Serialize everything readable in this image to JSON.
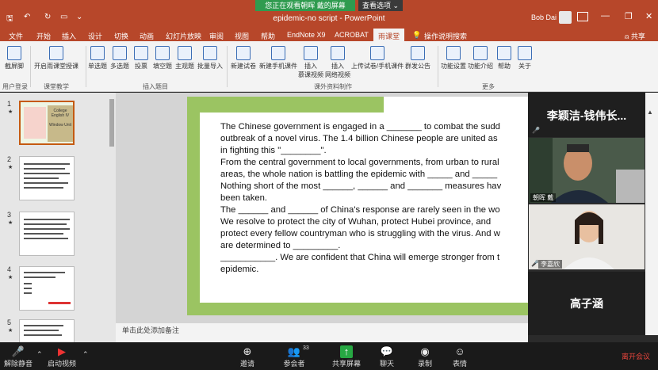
{
  "meeting": {
    "banner": "您正在观看朝晖 戴的屏幕",
    "view_options": "查看选项 ⌄"
  },
  "window": {
    "title": "epidemic-no script  -  PowerPoint",
    "user": "Bob Dai"
  },
  "tabs": [
    {
      "label": "文件"
    },
    {
      "label": "开始"
    },
    {
      "label": "插入"
    },
    {
      "label": "设计"
    },
    {
      "label": "切换"
    },
    {
      "label": "动画"
    },
    {
      "label": "幻灯片放映"
    },
    {
      "label": "审阅"
    },
    {
      "label": "视图"
    },
    {
      "label": "帮助"
    },
    {
      "label": "EndNote X9"
    },
    {
      "label": "ACROBAT"
    },
    {
      "label": "雨课堂"
    },
    {
      "label": "操作说明搜索"
    },
    {
      "label": "共享"
    }
  ],
  "ribbon": {
    "buttons": [
      {
        "label": "截屏脚"
      },
      {
        "label": "开启雨课堂授课"
      },
      {
        "label": "单选题"
      },
      {
        "label": "多选题"
      },
      {
        "label": "投票"
      },
      {
        "label": "填空题"
      },
      {
        "label": "主观题"
      },
      {
        "label": "批量导入"
      },
      {
        "label": "新建试卷"
      },
      {
        "label": "新建手机课件"
      },
      {
        "label": "插入"
      },
      {
        "label": "插入"
      },
      {
        "label": "上传试卷/手机课件"
      },
      {
        "label": "群发公告"
      },
      {
        "label": "功能设置"
      },
      {
        "label": "功能介绍"
      },
      {
        "label": "帮助"
      },
      {
        "label": "关于"
      }
    ],
    "sub_labels": {
      "mooc": "慕课视频",
      "web": "网络视频"
    },
    "groups": [
      {
        "label": "用户登录"
      },
      {
        "label": "课堂教学"
      },
      {
        "label": "插入题目"
      },
      {
        "label": "课外资料制作"
      },
      {
        "label": "更多"
      }
    ]
  },
  "thumbnails": [
    {
      "num": "1",
      "star": "★",
      "title": "College English IV",
      "sub": "Window Unit"
    },
    {
      "num": "2",
      "star": "★"
    },
    {
      "num": "3",
      "star": "★"
    },
    {
      "num": "4",
      "star": "★"
    },
    {
      "num": "5",
      "star": "★"
    }
  ],
  "slide": {
    "lines": [
      "The Chinese government is engaged in a _______ to combat the sudd",
      "outbreak of a novel virus. The 1.4 billion Chinese people are united as",
      "in fighting this \"________\".",
      "From the central government to local governments, from urban to rural",
      "areas, the whole nation is battling the epidemic with _____ and _____",
      "Nothing short of the most ______, ______ and _______ measures hav",
      "been taken.",
      "The ______ and ______ of China's response are rarely seen in the wo",
      "We resolve to protect the city of Wuhan, protect Hubei province, and",
      "protect every fellow countryman who is struggling with the virus. And w",
      "are determined to _________.",
      "___________. We are confident that China will emerge stronger from t",
      "epidemic."
    ]
  },
  "notes_placeholder": "单击此处添加备注",
  "participants": {
    "active_speaker": "李颖洁-钱伟长...",
    "tile1_name": "朝晖 戴",
    "tile2_name": "李嘉欣",
    "tile3_name": "高子涵"
  },
  "bottombar": {
    "mute": "解除静音",
    "video": "启动视频",
    "invite": "邀请",
    "participants": "参会者",
    "participant_count": "33",
    "share": "共享屏幕",
    "chat": "聊天",
    "record": "录制",
    "reactions": "表情",
    "leave": "离开会议"
  }
}
